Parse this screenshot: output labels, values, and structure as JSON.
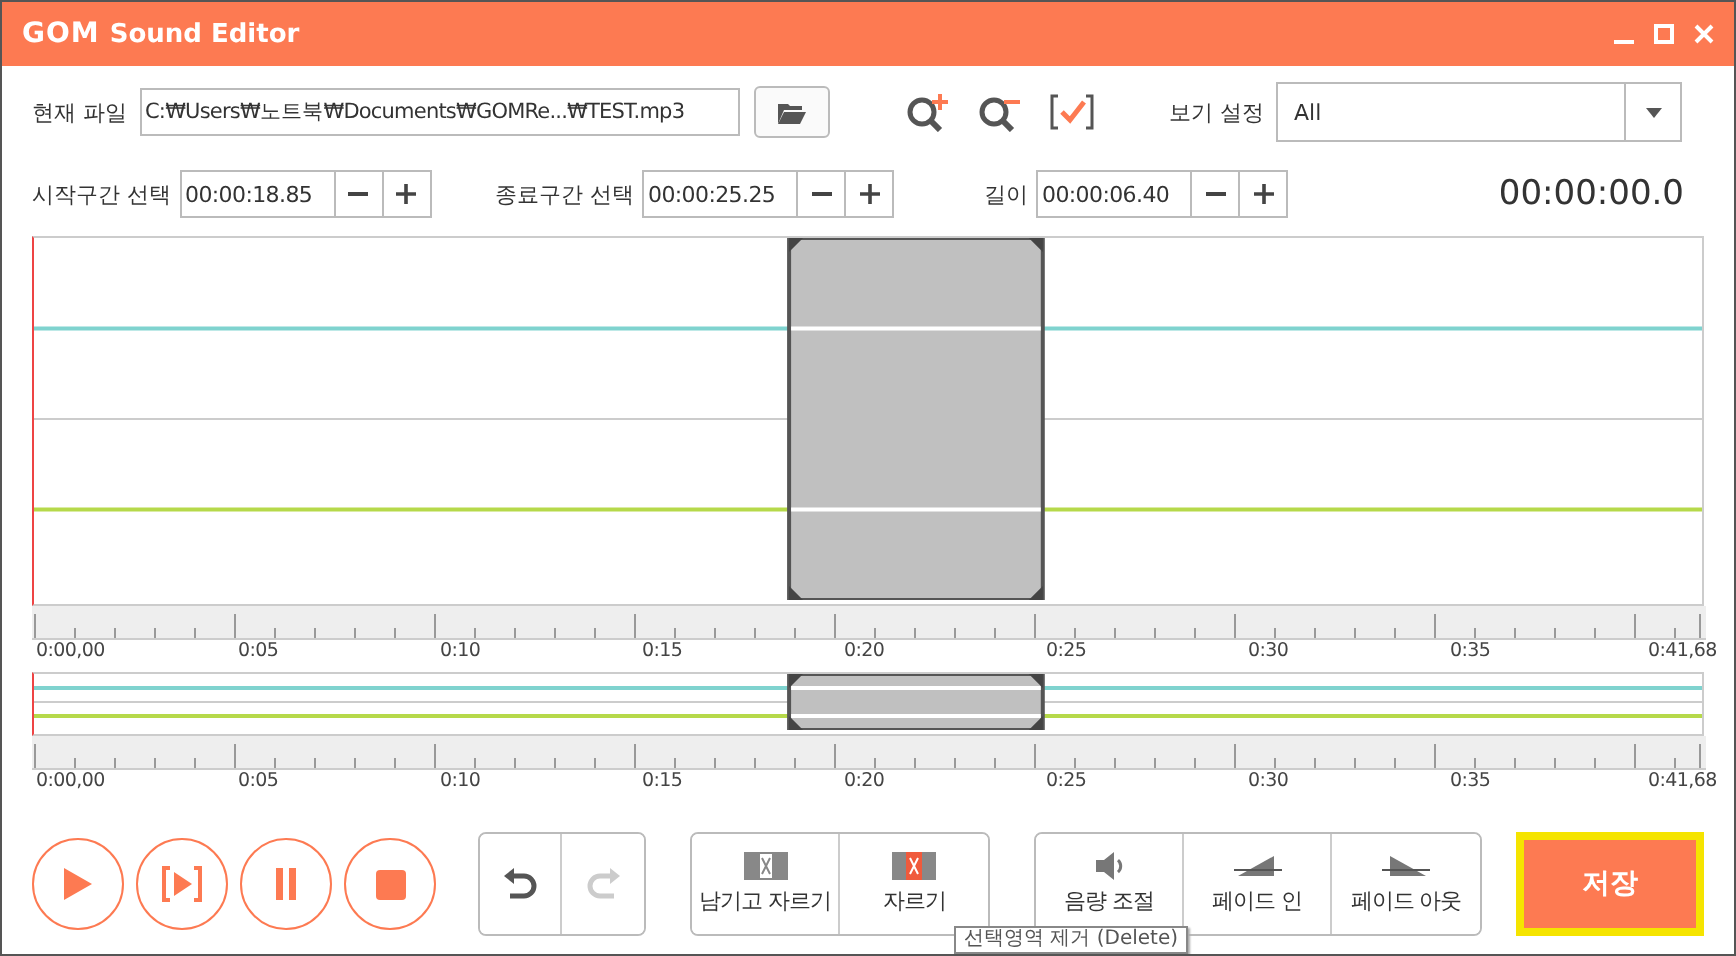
{
  "window": {
    "logo": "GOM",
    "title": "Sound Editor"
  },
  "file": {
    "label": "현재 파일",
    "path": "C:₩Users₩노트북₩Documents₩GOMRe...₩TEST.mp3"
  },
  "view": {
    "label": "보기 설정",
    "value": "All"
  },
  "ranges": [
    {
      "label": "시작구간 선택",
      "value": "00:00:18.85"
    },
    {
      "label": "종료구간 선택",
      "value": "00:00:25.25"
    },
    {
      "label": "길이",
      "value": "00:00:06.40"
    }
  ],
  "position": "00:00:00.0",
  "ruler_labels": [
    "0:00,00",
    "0:05",
    "0:10",
    "0:15",
    "0:20",
    "0:25",
    "0:30",
    "0:35",
    "0:41,68"
  ],
  "mini_ruler_labels": [
    "0:00,00",
    "0:05",
    "0:10",
    "0:15",
    "0:20",
    "0:25",
    "0:30",
    "0:35",
    "0:41,68"
  ],
  "history": [
    {
      "kind": "undo",
      "disabled": false
    },
    {
      "kind": "redo",
      "disabled": true
    }
  ],
  "edit_tools": [
    {
      "kind": "keep",
      "label": "남기고 자르기"
    },
    {
      "kind": "cut",
      "label": "자르기"
    }
  ],
  "effects": [
    {
      "kind": "volume",
      "label": "음량 조절"
    },
    {
      "kind": "fade_in",
      "label": "페이드 인"
    },
    {
      "kind": "fade_out",
      "label": "페이드 아웃"
    }
  ],
  "tooltip": "선택영역 제거 (Delete)",
  "save": "저장"
}
